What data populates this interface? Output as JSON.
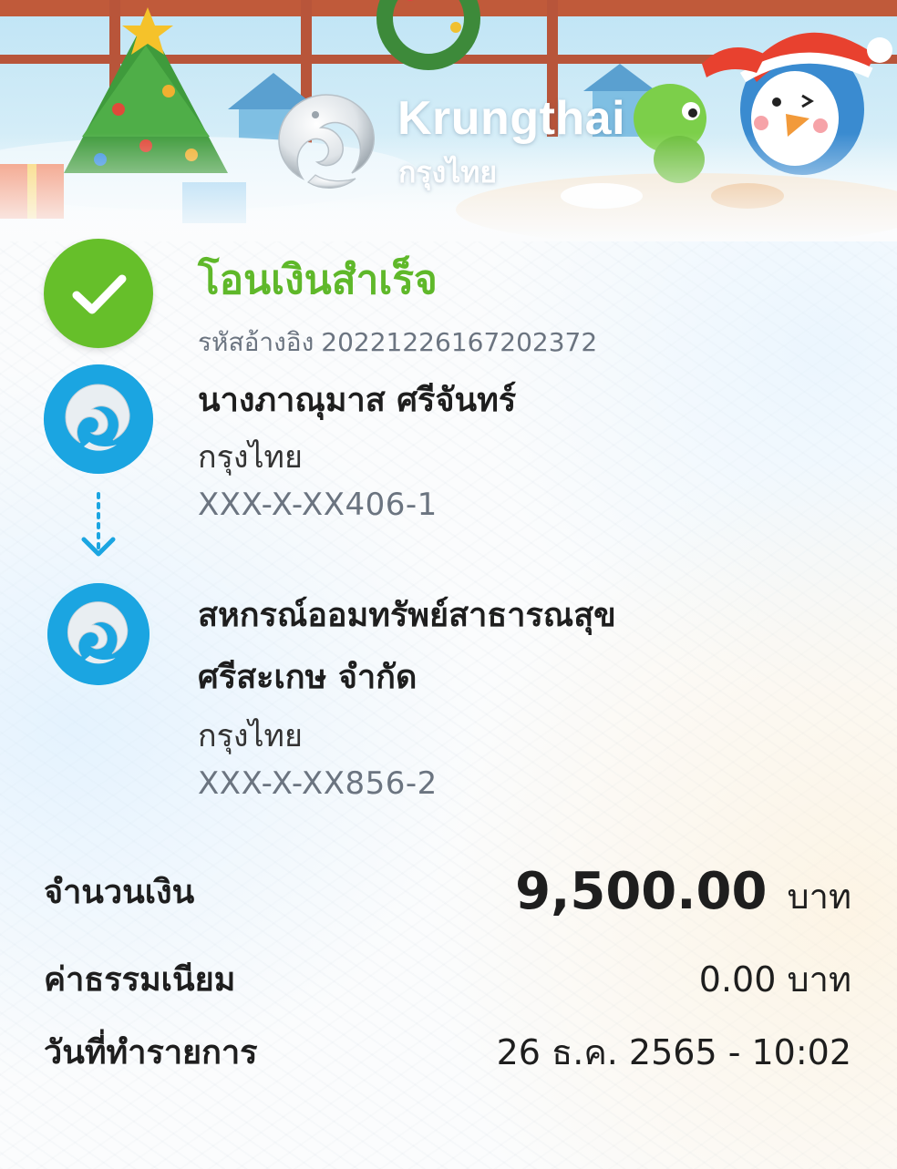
{
  "header": {
    "brand_en": "Krungthai",
    "brand_th": "กรุงไทย",
    "logo_icon": "krungthai-bird-logo-icon"
  },
  "status": {
    "icon": "check-icon",
    "title": "โอนเงินสำเร็จ",
    "ref_label": "รหัสอ้างอิง",
    "ref_code": "20221226167202372",
    "color": "#66bf2a"
  },
  "sender": {
    "name": "นางภาณุมาส ศรีจันทร์",
    "bank": "กรุงไทย",
    "account": "XXX-X-XX406-1",
    "avatar_icon": "krungthai-bank-icon"
  },
  "transfer_arrow_icon": "dotted-arrow-down-icon",
  "receiver": {
    "name_line1": "สหกรณ์ออมทรัพย์สาธารณสุข",
    "name_line2": "ศรีสะเกษ จำกัด",
    "bank": "กรุงไทย",
    "account": "XXX-X-XX856-2",
    "avatar_icon": "krungthai-bank-icon"
  },
  "details": {
    "amount_label": "จำนวนเงิน",
    "amount_value": "9,500.00",
    "amount_unit": "บาท",
    "fee_label": "ค่าธรรมเนียม",
    "fee_value": "0.00 บาท",
    "date_label": "วันที่ทำรายการ",
    "date_value": "26 ธ.ค. 2565 - 10:02"
  },
  "colors": {
    "accent_green": "#5fb82a",
    "bank_blue": "#1ba5e1",
    "muted_text": "#6b7480"
  }
}
